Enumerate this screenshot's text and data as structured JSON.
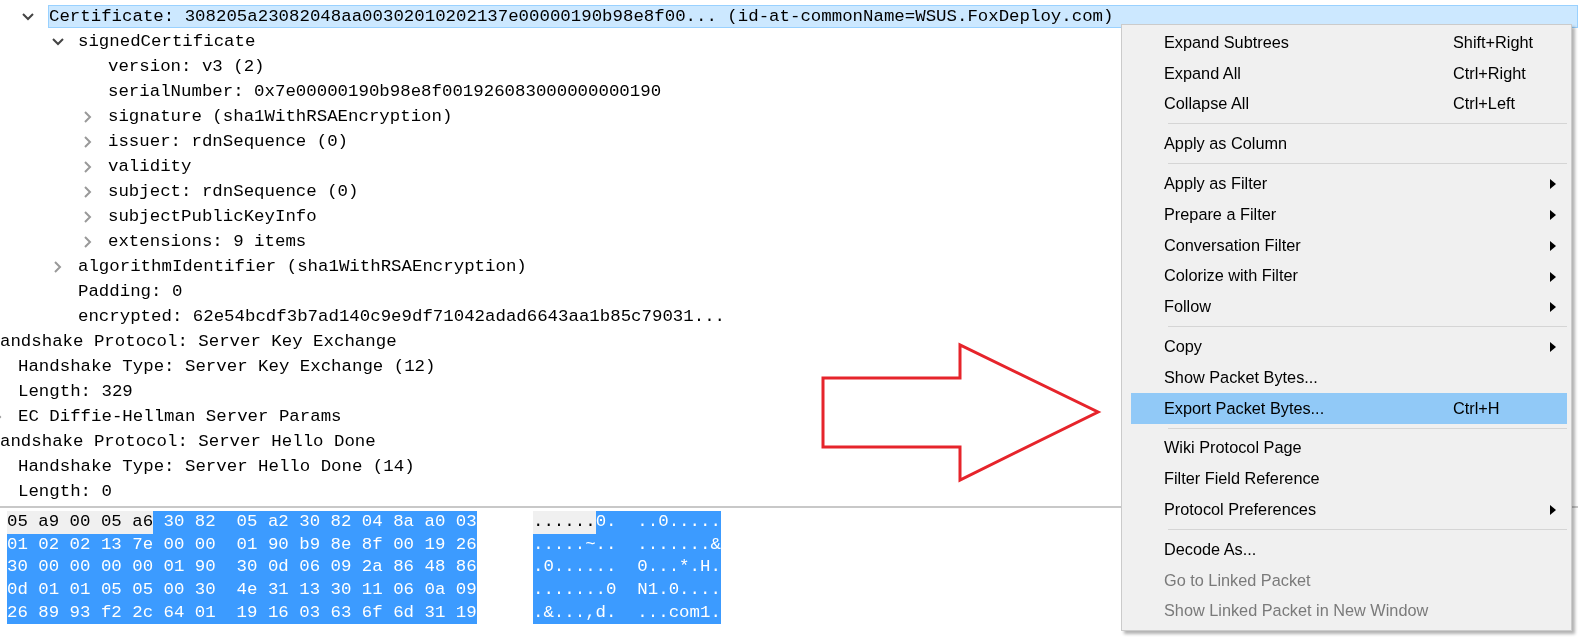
{
  "packet_tree": {
    "certificate": [
      {
        "text": "Certificate: 308205a23082048aa00302010202137e00000190b98e8f00... (id-at-commonName=WSUS.FoxDeploy.com)",
        "expanded": true,
        "selected": true,
        "children": [
          {
            "text": "signedCertificate",
            "expanded": true,
            "selected": false,
            "children": [
              {
                "text": "version: v3 (2)",
                "selected": false
              },
              {
                "text": "serialNumber: 0x7e00000190b98e8f001926083000000000190",
                "selected": false
              },
              {
                "text": "signature (sha1WithRSAEncryption)",
                "expanded": false,
                "selected": false
              },
              {
                "text": "issuer: rdnSequence (0)",
                "expanded": false,
                "selected": false
              },
              {
                "text": "validity",
                "expanded": false,
                "selected": false
              },
              {
                "text": "subject: rdnSequence (0)",
                "expanded": false,
                "selected": false
              },
              {
                "text": "subjectPublicKeyInfo",
                "expanded": false,
                "selected": false
              },
              {
                "text": "extensions: 9 items",
                "expanded": false,
                "selected": false
              }
            ]
          },
          {
            "text": "algorithmIdentifier (sha1WithRSAEncryption)",
            "expanded": false,
            "selected": false
          },
          {
            "text": "Padding: 0",
            "selected": false
          },
          {
            "text": "encrypted: 62e54bcdf3b7ad140c9e9df71042adad6643aa1b85c79031...",
            "selected": false
          }
        ]
      }
    ],
    "handshake": [
      {
        "text": "andshake Protocol: Server Key Exchange",
        "selected": false,
        "children": [
          {
            "text": "Handshake Type: Server Key Exchange (12)",
            "selected": false
          },
          {
            "text": "Length: 329",
            "selected": false
          },
          {
            "text": "EC Diffie-Hellman Server Params",
            "expanded": false,
            "selected": false
          }
        ]
      },
      {
        "text": "andshake Protocol: Server Hello Done",
        "selected": false,
        "children": [
          {
            "text": "Handshake Type: Server Hello Done (14)",
            "selected": false
          },
          {
            "text": "Length: 0",
            "selected": false
          }
        ]
      }
    ]
  },
  "bytes": [
    {
      "hex": [
        {
          "text": "05 a9 00 05 a6",
          "selected": false
        },
        {
          "text": " 30 82  05 a2 30 82 04 8a a0 03",
          "selected": true
        }
      ],
      "ascii": [
        {
          "text": "......",
          "selected": false
        },
        {
          "text": "0.  ..0.....",
          "selected": true
        }
      ]
    },
    {
      "hex": [
        {
          "text": "01 02 02 13 7e 00 00  01 90 b9 8e 8f 00 19 26",
          "selected": true
        }
      ],
      "ascii": [
        {
          "text": ".....~..  .......&",
          "selected": true
        }
      ]
    },
    {
      "hex": [
        {
          "text": "30 00 00 00 00 01 90  30 0d 06 09 2a 86 48 86",
          "selected": true
        }
      ],
      "ascii": [
        {
          "text": ".0......  0...*.H.",
          "selected": true
        }
      ]
    },
    {
      "hex": [
        {
          "text": "0d 01 01 05 05 00 30  4e 31 13 30 11 06 0a 09",
          "selected": true
        }
      ],
      "ascii": [
        {
          "text": ".......0  N1.0....",
          "selected": true
        }
      ]
    },
    {
      "hex": [
        {
          "text": "26 89 93 f2 2c 64 01  19 16 03 63 6f 6d 31 19",
          "selected": true
        }
      ],
      "ascii": [
        {
          "text": ".&...,d.  ...com1.",
          "selected": true
        }
      ]
    }
  ],
  "context_menu": [
    {
      "kind": "item",
      "label": "Expand Subtrees",
      "shortcut": "Shift+Right",
      "submenu": false,
      "disabled": false,
      "selected": false
    },
    {
      "kind": "item",
      "label": "Expand All",
      "shortcut": "Ctrl+Right",
      "submenu": false,
      "disabled": false,
      "selected": false
    },
    {
      "kind": "item",
      "label": "Collapse All",
      "shortcut": "Ctrl+Left",
      "submenu": false,
      "disabled": false,
      "selected": false
    },
    {
      "kind": "separator"
    },
    {
      "kind": "item",
      "label": "Apply as Column",
      "submenu": false,
      "disabled": false,
      "selected": false
    },
    {
      "kind": "separator"
    },
    {
      "kind": "item",
      "label": "Apply as Filter",
      "submenu": true,
      "disabled": false,
      "selected": false
    },
    {
      "kind": "item",
      "label": "Prepare a Filter",
      "submenu": true,
      "disabled": false,
      "selected": false
    },
    {
      "kind": "item",
      "label": "Conversation Filter",
      "submenu": true,
      "disabled": false,
      "selected": false
    },
    {
      "kind": "item",
      "label": "Colorize with Filter",
      "submenu": true,
      "disabled": false,
      "selected": false
    },
    {
      "kind": "item",
      "label": "Follow",
      "submenu": true,
      "disabled": false,
      "selected": false
    },
    {
      "kind": "separator"
    },
    {
      "kind": "item",
      "label": "Copy",
      "submenu": true,
      "disabled": false,
      "selected": false
    },
    {
      "kind": "item",
      "label": "Show Packet Bytes...",
      "submenu": false,
      "disabled": false,
      "selected": false
    },
    {
      "kind": "item",
      "label": "Export Packet Bytes...",
      "shortcut": "Ctrl+H",
      "submenu": false,
      "disabled": false,
      "selected": true
    },
    {
      "kind": "separator"
    },
    {
      "kind": "item",
      "label": "Wiki Protocol Page",
      "submenu": false,
      "disabled": false,
      "selected": false
    },
    {
      "kind": "item",
      "label": "Filter Field Reference",
      "submenu": false,
      "disabled": false,
      "selected": false
    },
    {
      "kind": "item",
      "label": "Protocol Preferences",
      "submenu": true,
      "disabled": false,
      "selected": false
    },
    {
      "kind": "separator"
    },
    {
      "kind": "item",
      "label": "Decode As...",
      "submenu": false,
      "disabled": false,
      "selected": false
    },
    {
      "kind": "item",
      "label": "Go to Linked Packet",
      "submenu": false,
      "disabled": true,
      "selected": false
    },
    {
      "kind": "item",
      "label": "Show Linked Packet in New Window",
      "submenu": false,
      "disabled": true,
      "selected": false
    }
  ]
}
